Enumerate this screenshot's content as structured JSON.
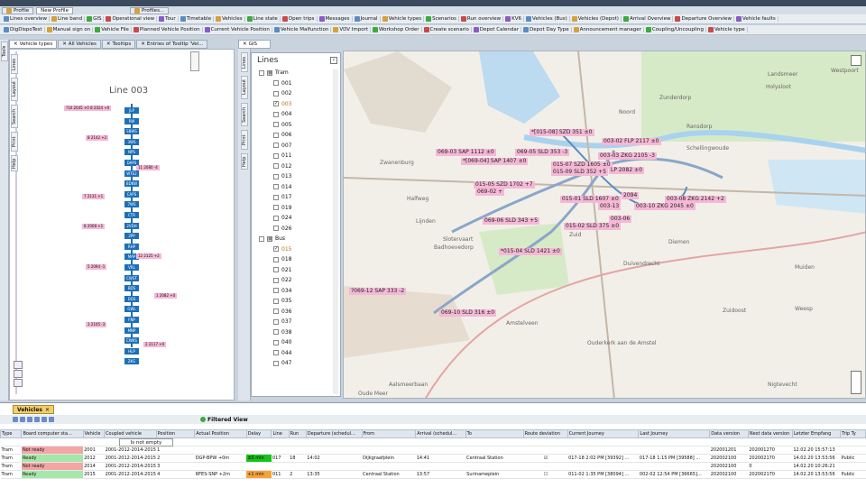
{
  "profile_tabs": [
    "Profile",
    "New Profile",
    "Profiles..."
  ],
  "toolbar1": [
    "Lines overview",
    "Line band",
    "GIS",
    "Operational view",
    "Tour",
    "Timetable",
    "Vehicles",
    "Line state",
    "Open trips",
    "Messages",
    "Journal",
    "Vehicle types",
    "Scenarios",
    "Run overview",
    "KV6",
    "Vehicles (Bus)",
    "Vehicles (Depot)",
    "Arrival Overview",
    "Departure Overview",
    "Vehicle faults"
  ],
  "toolbar2": [
    "DigDispoTest",
    "Manual sign on",
    "Vehicle File",
    "Planned Vehicle Position",
    "Current Vehicle Position",
    "Vehicle Malfunction",
    "VDV Import",
    "Workshop Order",
    "Create scenario",
    "Depot Calendar",
    "Depot Day Type",
    "Announcement manager",
    "Coupling/Uncoupling",
    "Vehicle type"
  ],
  "doc_tabs": [
    "Vehicle types",
    "All Vehicles",
    "Tooltips",
    "Entries of Tooltip 'Vel..."
  ],
  "gis_tab": "GIS",
  "side_tabs_left": [
    "Tools",
    "Lines",
    "Layout",
    "Search",
    "Print",
    "Help"
  ],
  "side_tabs_gis": [
    "Lines",
    "Layout",
    "Search",
    "Print",
    "Help"
  ],
  "line_title": "Line 003",
  "stops": [
    "JLP",
    "RW",
    "SBWS",
    "3WS",
    "NPS",
    "DAPS",
    "WTE2",
    "BDKW",
    "CAPS",
    "7WS",
    "CTR",
    "2VDH",
    "2PP",
    "RHP",
    "MAP",
    "VRL",
    "CWST",
    "BDS",
    "DQS",
    "GWL",
    "FNP",
    "MNP",
    "CWKS",
    "HLP",
    "ZKG"
  ],
  "line_labels": [
    "?10 2045 +0 8 2024 +0",
    "8 2142 +2",
    "11 2080 -4",
    "7 2131 +1",
    "8 2008 +1",
    "12 2125 +2",
    "5 2094 -1",
    "1 2082 +0",
    "3 2105 -3",
    "2 2117 +0"
  ],
  "lines_panel": {
    "title": "Lines",
    "tram_label": "Tram",
    "bus_label": "Bus",
    "tram_lines": [
      "001",
      "002",
      "003",
      "004",
      "005",
      "006",
      "007",
      "011",
      "012",
      "013",
      "014",
      "017",
      "019",
      "024",
      "026"
    ],
    "tram_checked": "003",
    "bus_lines": [
      "015",
      "018",
      "021",
      "022",
      "034",
      "035",
      "036",
      "037",
      "038",
      "040",
      "044",
      "047"
    ],
    "bus_checked": "015"
  },
  "map_places": [
    "Westpoort",
    "Landsmeer",
    "Zunderdorp",
    "Holysloot",
    "Noord",
    "Ransdorp",
    "Zwanenburg",
    "Schellingwoude",
    "Halfweg",
    "Lijnden",
    "Slotervaart",
    "Badhoevedorp",
    "Zuid",
    "Diemen",
    "Duivendrecht",
    "Muiden",
    "Amstelveen",
    "Zuidoost",
    "Weesp",
    "Ouderkerk aan de Amstel",
    "Aalsmeerbaan",
    "Nigtevecht",
    "Oude Meer"
  ],
  "map_vehicles": [
    "*[015-08] SZD 351 ±0",
    "003-02 FLP 2117 ±0",
    "069-03 SAP 1112 ±0",
    "069-05 SLD 353 -3",
    "*[069-04] SAP 1407 ±0",
    "003-03 ZKG 2105 -3",
    "015-07 SZD 1605 ±0",
    "015-09 SLD 352 +5",
    "LP 2082 ±0",
    "015-05 SZD 1702 +7",
    "069-02 +",
    "015-01 SLD 1607 ±0",
    "2094",
    "003-13",
    "003-08 ZKG 2142 +2",
    "003-10 ZKG 2045 ±0",
    "003-06",
    "069-06 SLD 343 +5",
    "015-02 SLD 375 ±0",
    "*015-04 SLD 1421 ±0",
    "?069-12 SAP 333 -2",
    "069-10 SLD 316 ±0"
  ],
  "vehicles_panel": {
    "tab": "Vehicles",
    "filter": "Filtered View",
    "filter_cell": "Is not empty",
    "columns": [
      "Type",
      "Board computer sta...",
      "Vehicle",
      "Coupled vehicle",
      "Position",
      "Actual Position",
      "Delay",
      "Line",
      "Run",
      "Departure (schedul...",
      "From",
      "Arrival (schedul...",
      "To",
      "Route deviation",
      "Current Journey",
      "Last Journey",
      "Data version",
      "Next data version",
      "Letzter Empfang",
      "Trip Ty"
    ],
    "rows": [
      [
        "Tram",
        "Not ready",
        "2001",
        "2001-2012-2014-2015",
        "1",
        "",
        "",
        "",
        "",
        "",
        "",
        "",
        "",
        "",
        "",
        "",
        "202001201",
        "202001270",
        "12.02.20 15:57:13",
        ""
      ],
      [
        "Tram",
        "Ready",
        "2012",
        "2001-2012-2014-2015",
        "2",
        "DGP-BPW +0m",
        "±0 min",
        "017",
        "18",
        "14:02",
        "Dijkgraafplein",
        "14:41",
        "Centraal Station",
        "☑",
        "017-18 2:02 PM [39392] ...",
        "017-18 1:15 PM [39588] ...",
        "202002100",
        "202002170",
        "14.02.20 13:53:56",
        "Public"
      ],
      [
        "Tram",
        "Not ready",
        "2014",
        "2001-2012-2014-2015",
        "3",
        "",
        "",
        "",
        "",
        "",
        "",
        "",
        "",
        "",
        "",
        "",
        "202002100",
        "0",
        "14.02.20 10:26:21",
        ""
      ],
      [
        "Tram",
        "Ready",
        "2015",
        "2001-2012-2014-2015",
        "4",
        "RFES-SNP +2m",
        "+1 min",
        "011",
        "2",
        "13:35",
        "Centraal Station",
        "13:57",
        "Surinameplein",
        "☐",
        "011-02 1:35 PM [38094] ...",
        "002-02 12:54 PM [36665]...",
        "202002100",
        "202002170",
        "14.02.20 13:53:56",
        "Public"
      ]
    ]
  },
  "colors": {
    "accent": "#1d6fb8",
    "ready": "#a6e6a8",
    "not_ready": "#f3a6a6",
    "delay_ok": "#19c219",
    "delay_late": "#f6a23a",
    "label_pink": "#f5b8d6",
    "tab_active": "#f4cf6a"
  }
}
